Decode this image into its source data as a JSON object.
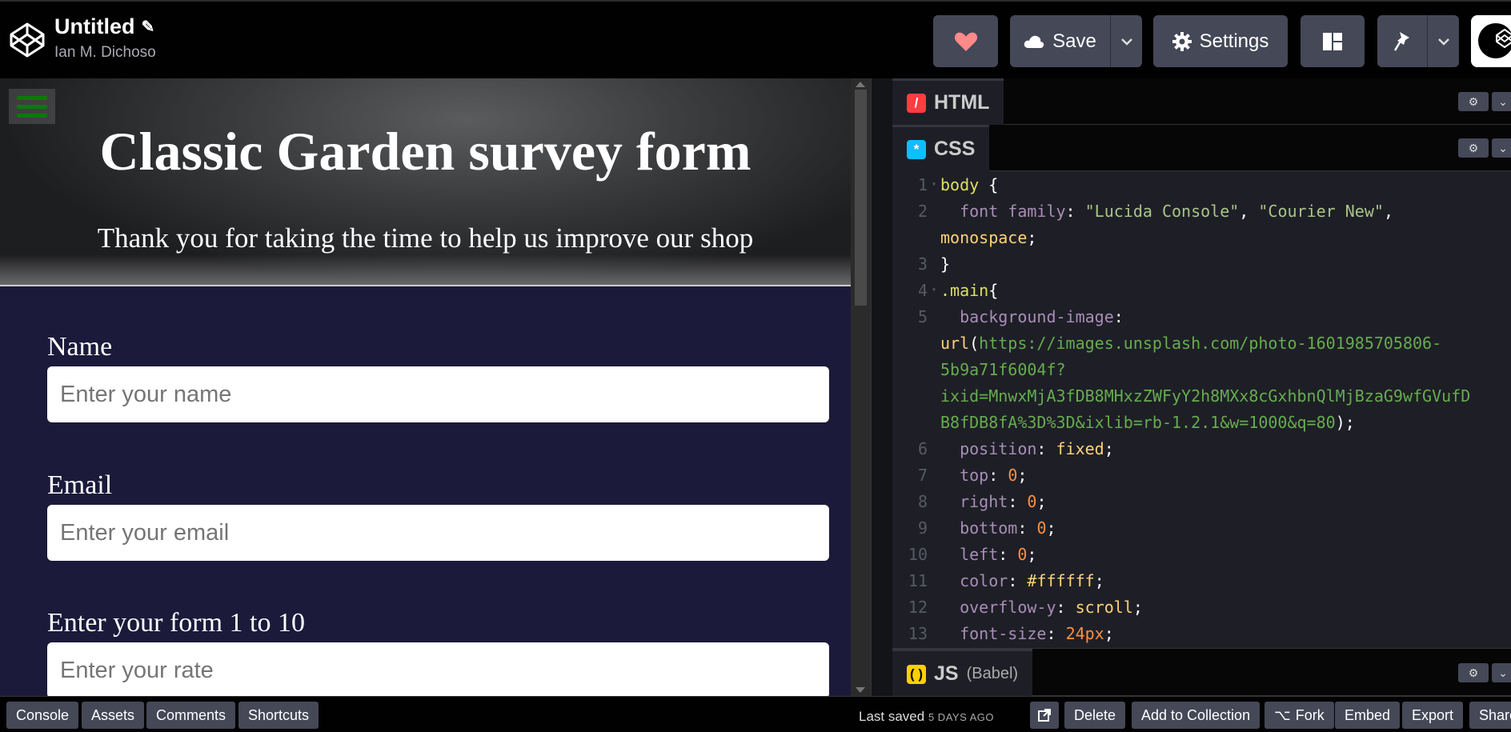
{
  "header": {
    "title": "Untitled",
    "author": "Ian M. Dichoso",
    "save_label": "Save",
    "settings_label": "Settings"
  },
  "preview": {
    "form_title": "Classic Garden survey form",
    "form_description": "Thank you for taking the time to help us improve our shop",
    "fields": [
      {
        "label": "Name",
        "placeholder": "Enter your name"
      },
      {
        "label": "Email",
        "placeholder": "Enter your email"
      },
      {
        "label": "Enter your form 1 to 10",
        "placeholder": "Enter your rate"
      }
    ]
  },
  "editors": {
    "html_tab": "HTML",
    "css_tab": "CSS",
    "js_tab": "JS",
    "js_sub": "(Babel)"
  },
  "code": {
    "line_numbers": [
      "1",
      "2",
      "",
      "3",
      "4",
      "5",
      "",
      "",
      "",
      "",
      "6",
      "7",
      "8",
      "9",
      "10",
      "11",
      "12",
      "13"
    ],
    "lines": [
      "body {",
      "  font family: \"Lucida Console\", \"Courier New\",",
      "monospace;",
      "}",
      ".main{",
      "  background-image:",
      "url(https://images.unsplash.com/photo-1601985705806-",
      "5b9a71f6004f?",
      "ixid=MnwxMjA3fDB8MHxzZWFyY2h8MXx8cGxhbnQlMjBzaG9wfGVufD",
      "B8fDB8fA%3D%3D&ixlib=rb-1.2.1&w=1000&q=80);",
      "  position: fixed;",
      "  top: 0;",
      "  right: 0;",
      "  bottom: 0;",
      "  left: 0;",
      "  color: #ffffff;",
      "  overflow-y: scroll;",
      "  font-size: 24px;"
    ]
  },
  "footer": {
    "console": "Console",
    "assets": "Assets",
    "comments": "Comments",
    "shortcuts": "Shortcuts",
    "last_saved": "Last saved",
    "last_saved_ago": "5 DAYS AGO",
    "delete": "Delete",
    "add_to_collection": "Add to Collection",
    "fork": "Fork",
    "embed": "Embed",
    "export": "Export",
    "share": "Share"
  },
  "colors": {
    "html_badge": "#ff3c41",
    "css_badge": "#0ebeff",
    "js_badge": "#fcd000",
    "heart": "#ff8a8a",
    "hamburger": "#0a7a0a"
  }
}
